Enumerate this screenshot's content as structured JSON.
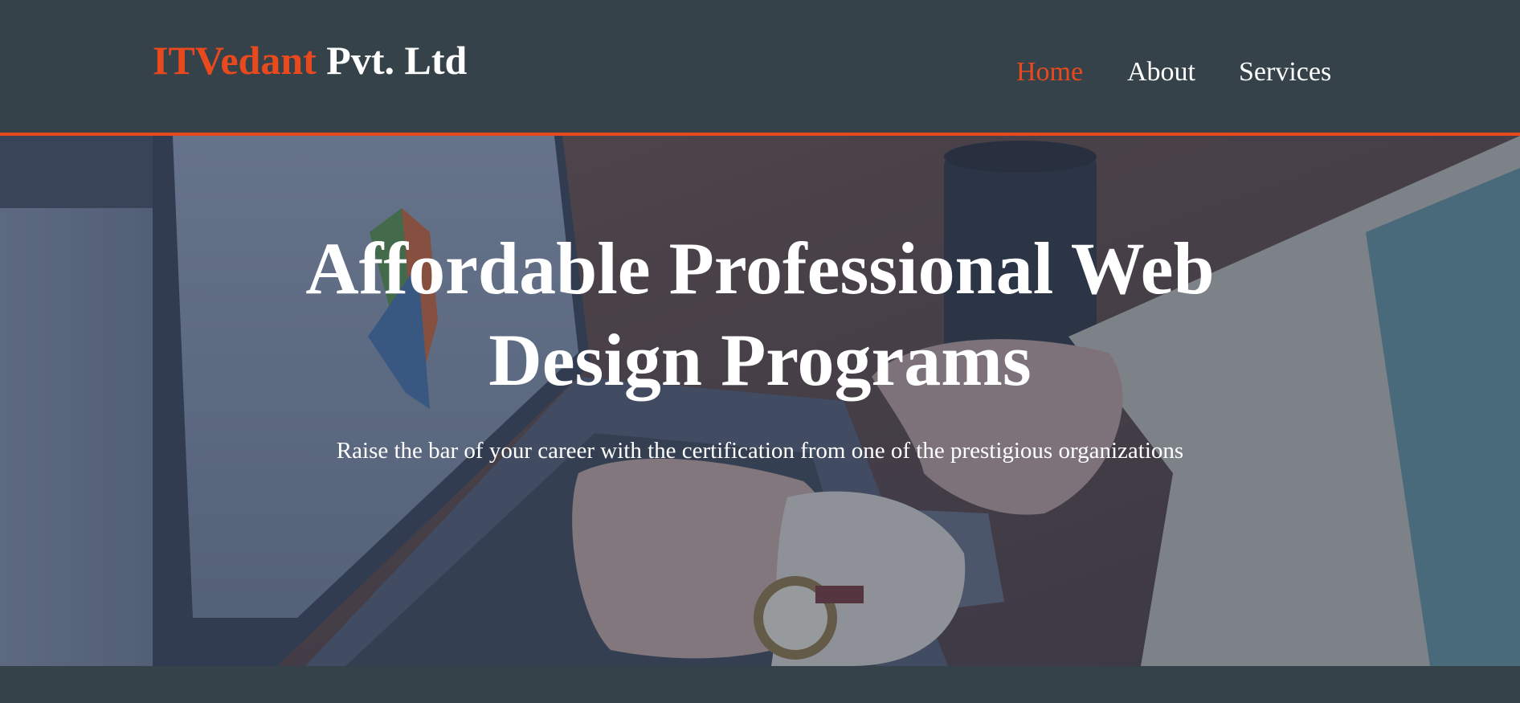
{
  "header": {
    "brand_highlight": "ITVedant",
    "brand_rest": " Pvt. Ltd",
    "nav": {
      "home": "Home",
      "about": "About",
      "services": "Services"
    }
  },
  "showcase": {
    "title": "Affordable Professional Web Design Programs",
    "subtitle": "Raise the bar of your career with the certification from one of the prestigious organizations"
  },
  "colors": {
    "accent": "#e8491d",
    "header_bg": "#35424a",
    "text": "#ffffff"
  }
}
